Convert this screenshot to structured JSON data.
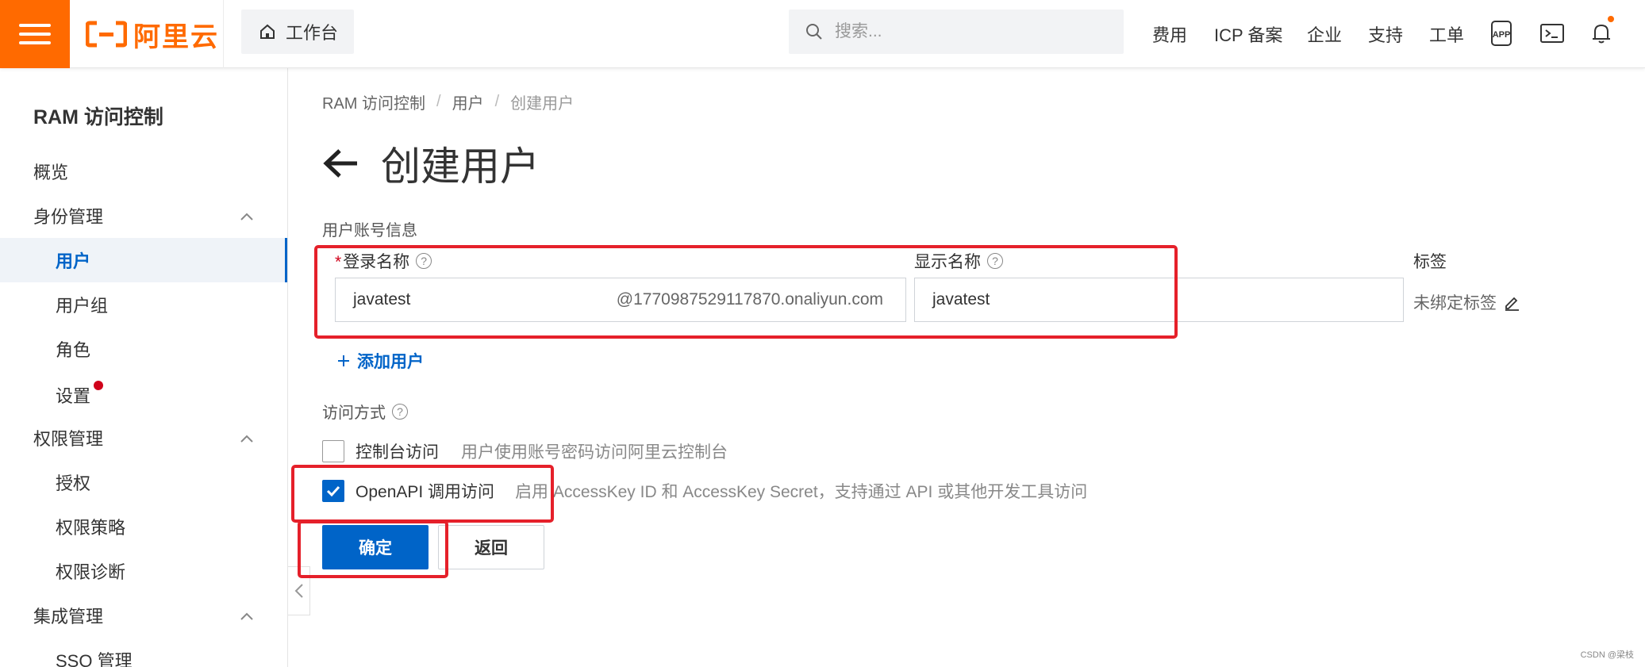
{
  "topbar": {
    "logo_text": "阿里云",
    "workbench_label": "工作台",
    "search_placeholder": "搜索...",
    "nav": [
      "费用",
      "ICP 备案",
      "企业",
      "支持",
      "工单"
    ],
    "icons": [
      "app-icon",
      "terminal-icon",
      "bell-icon"
    ],
    "brand_color": "#ff6a00"
  },
  "sidebar": {
    "title": "RAM 访问控制",
    "items": [
      {
        "label": "概览",
        "level": 1
      },
      {
        "label": "身份管理",
        "level": 1,
        "expanded": true
      },
      {
        "label": "用户",
        "level": 2,
        "active": true
      },
      {
        "label": "用户组",
        "level": 2
      },
      {
        "label": "角色",
        "level": 2
      },
      {
        "label": "设置",
        "level": 2,
        "badge": "red-dot"
      },
      {
        "label": "权限管理",
        "level": 1,
        "expanded": true
      },
      {
        "label": "授权",
        "level": 2
      },
      {
        "label": "权限策略",
        "level": 2
      },
      {
        "label": "权限诊断",
        "level": 2
      },
      {
        "label": "集成管理",
        "level": 1,
        "expanded": true
      },
      {
        "label": "SSO 管理",
        "level": 2
      }
    ]
  },
  "breadcrumb": [
    "RAM 访问控制",
    "用户",
    "创建用户"
  ],
  "page_title": "创建用户",
  "form": {
    "section_account": "用户账号信息",
    "login_name_label": "登录名称",
    "login_name_value": "javatest",
    "login_name_suffix": "@1770987529117870.onaliyun.com",
    "display_name_label": "显示名称",
    "display_name_value": "javatest",
    "tags_label": "标签",
    "tags_value": "未绑定标签",
    "add_user": "添加用户",
    "access_label": "访问方式",
    "console_access_label": "控制台访问",
    "console_access_desc": "用户使用账号密码访问阿里云控制台",
    "console_access_checked": false,
    "openapi_label": "OpenAPI 调用访问",
    "openapi_desc": "启用 AccessKey ID 和 AccessKey Secret，支持通过 API 或其他开发工具访问",
    "openapi_checked": true
  },
  "buttons": {
    "confirm": "确定",
    "back": "返回"
  },
  "accent_color": "#0064c8",
  "highlight_color": "#e5202a",
  "watermark": "CSDN @梁枝"
}
